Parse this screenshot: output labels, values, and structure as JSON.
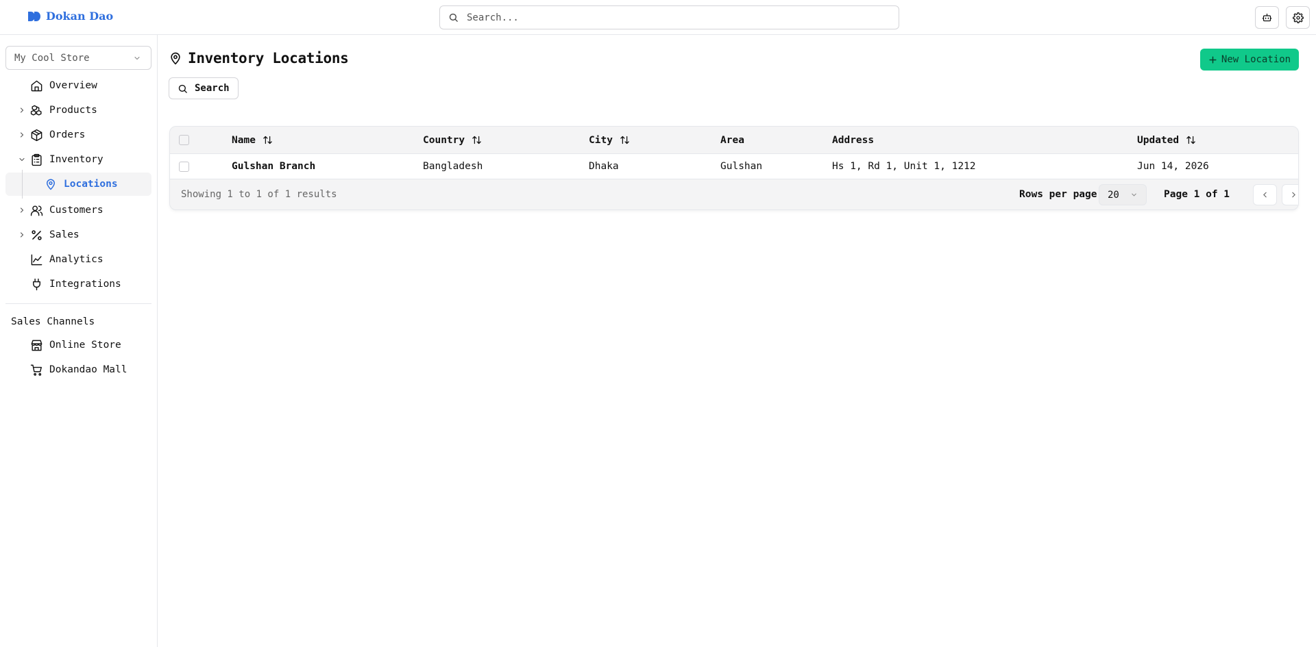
{
  "app": {
    "brand": "Dokan Dao",
    "search_placeholder": "Search...",
    "brand_color": "#2f6fde",
    "accent_color": "#10c98a"
  },
  "topbar": {
    "icons": [
      "robot-icon",
      "gear-icon"
    ]
  },
  "sidebar": {
    "store": "My Cool Store",
    "items": [
      {
        "label": "Overview",
        "icon": "home-icon",
        "expandable": false
      },
      {
        "label": "Products",
        "icon": "boxes-icon",
        "expandable": true
      },
      {
        "label": "Orders",
        "icon": "package-icon",
        "expandable": true
      },
      {
        "label": "Inventory",
        "icon": "clipboard-icon",
        "expandable": true,
        "expanded": true
      },
      {
        "label": "Customers",
        "icon": "users-icon",
        "expandable": true
      },
      {
        "label": "Sales",
        "icon": "percent-icon",
        "expandable": true
      },
      {
        "label": "Analytics",
        "icon": "line-chart-icon",
        "expandable": false
      },
      {
        "label": "Integrations",
        "icon": "plug-icon",
        "expandable": false
      }
    ],
    "sub_item": {
      "label": "Locations",
      "icon": "map-pin-icon",
      "active": true
    },
    "channels_title": "Sales Channels",
    "channels": [
      {
        "label": "Online Store",
        "icon": "store-icon"
      },
      {
        "label": "Dokandao Mall",
        "icon": "cart-icon"
      }
    ]
  },
  "main": {
    "title": "Inventory Locations",
    "new_button": "New Location",
    "search_button": "Search"
  },
  "table": {
    "columns": [
      "Name",
      "Country",
      "City",
      "Area",
      "Address",
      "Updated"
    ],
    "sortable": [
      true,
      true,
      true,
      false,
      false,
      true
    ],
    "rows": [
      {
        "name": "Gulshan Branch",
        "country": "Bangladesh",
        "city": "Dhaka",
        "area": "Gulshan",
        "address": "Hs 1, Rd 1, Unit 1, 1212",
        "updated": "Jun 14, 2026"
      }
    ],
    "results_text": "Showing 1 to 1 of 1 results",
    "rows_per_page_label": "Rows per page",
    "rows_per_page": "20",
    "page_text": "Page 1 of 1"
  }
}
